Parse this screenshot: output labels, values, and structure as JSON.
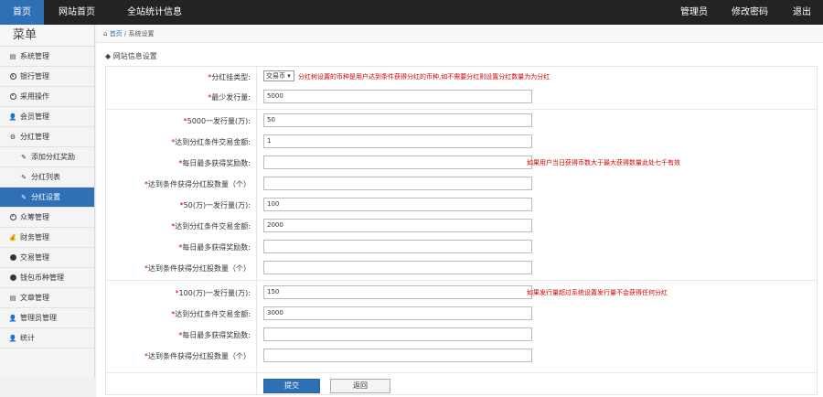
{
  "topnav": {
    "items": [
      "首页",
      "网站首页",
      "全站统计信息"
    ],
    "right": [
      "管理员",
      "修改密码",
      "退出"
    ]
  },
  "sidebar": {
    "title": "菜单",
    "items": [
      {
        "label": "系统管理",
        "icon": "document-icon"
      },
      {
        "label": "银行管理",
        "icon": "circle-icon"
      },
      {
        "label": "采用操作",
        "icon": "circle-icon"
      },
      {
        "label": "会员管理",
        "icon": "user-icon"
      },
      {
        "label": "分红管理",
        "icon": "gear-icon"
      },
      {
        "label": "添加分红奖励",
        "icon": "wrench-icon",
        "sub": true
      },
      {
        "label": "分红列表",
        "icon": "wrench-icon",
        "sub": true
      },
      {
        "label": "分红设置",
        "icon": "wrench-icon",
        "sub": true,
        "selected": true
      },
      {
        "label": "众筹管理",
        "icon": "circle-icon"
      },
      {
        "label": "财务管理",
        "icon": "bag-icon"
      },
      {
        "label": "交易管理",
        "icon": "circle-filled-icon"
      },
      {
        "label": "钱包币种管理",
        "icon": "circle-filled-icon"
      },
      {
        "label": "文章管理",
        "icon": "document-icon"
      },
      {
        "label": "管理员管理",
        "icon": "user-icon"
      },
      {
        "label": "统计",
        "icon": "user-icon"
      }
    ]
  },
  "breadcrumb": {
    "home": "首页",
    "current": "系统设置"
  },
  "section_title": "网站信息设置",
  "form": {
    "mode_label": "分红挂类型:",
    "mode_value": "交易币",
    "mode_note": "分红树设置的币种是用户达到条件获得分红的币种,如不需要分红则设置分红数量为为分红",
    "rows": [
      {
        "label": "最少发行量:",
        "value": "5000"
      },
      {
        "label": "5000一发行量(万):",
        "value": "50"
      },
      {
        "label": "达到分红条件交易金额:",
        "value": "1"
      },
      {
        "label": "每日最多获得奖励数:",
        "value": "",
        "note": "如果用户当日获得币数大于最大获得数量此处七千有效"
      },
      {
        "label": "达到条件获得分红股数量（个）",
        "value": ""
      },
      {
        "label": "50(万)一发行量(万):",
        "value": "100"
      },
      {
        "label": "达到分红条件交易金额:",
        "value": "2000"
      },
      {
        "label": "每日最多获得奖励数:",
        "value": ""
      },
      {
        "label": "达到条件获得分红股数量（个）",
        "value": ""
      },
      {
        "label": "100(万)一发行量(万):",
        "value": "150",
        "note": "如果发行量超过系统设置发行量不会获得任何分红"
      },
      {
        "label": "达到分红条件交易金额:",
        "value": "3000"
      },
      {
        "label": "每日最多获得奖励数:",
        "value": ""
      },
      {
        "label": "达到条件获得分红股数量（个）",
        "value": ""
      }
    ],
    "submit_label": "提交",
    "back_label": "返回"
  }
}
